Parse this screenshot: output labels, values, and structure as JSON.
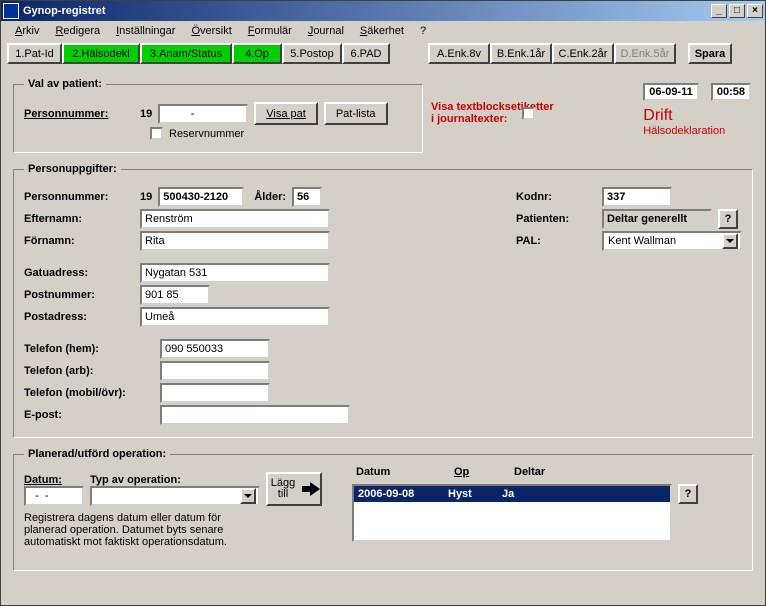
{
  "window": {
    "title": "Gynop-registret"
  },
  "menu": {
    "arkiv": "Arkiv",
    "redigera": "Redigera",
    "installningar": "Inställningar",
    "oversikt": "Översikt",
    "formular": "Formulär",
    "journal": "Journal",
    "sakerhet": "Säkerhet",
    "help": "?"
  },
  "tabs": {
    "t1": "1.Pat-Id",
    "t2": "2.Hälsodekl",
    "t3": "3.Anam/Status",
    "t4": "4.Op",
    "t5": "5.Postop",
    "t6": "6.PAD",
    "a": "A.Enk.8v",
    "b": "B.Enk.1år",
    "c": "C.Enk.2år",
    "d": "D.Enk.5år",
    "spara": "Spara"
  },
  "val": {
    "legend": "Val av patient:",
    "personnummer_label": "Personnummer:",
    "prefix": "19",
    "pnr_value": "         -",
    "visa_pat": "Visa pat",
    "pat_lista": "Pat-lista",
    "reservnummer": "Reservnummer"
  },
  "red": {
    "line1": "Visa textblocksetiketter",
    "line2": "i journaltexter:"
  },
  "status": {
    "date": "06-09-11",
    "time": "00:58",
    "mode": "Drift",
    "sub": "Hälsodeklaration"
  },
  "person": {
    "legend": "Personuppgifter:",
    "personnummer_label": "Personnummer:",
    "prefix": "19",
    "pnr": "500430-2120",
    "alder_label": "Ålder:",
    "alder": "56",
    "efternamn_label": "Efternamn:",
    "efternamn": "Renström",
    "fornamn_label": "Förnamn:",
    "fornamn": "Rita",
    "gatuadress_label": "Gatuadress:",
    "gatuadress": "Nygatan 531",
    "postnummer_label": "Postnummer:",
    "postnummer": "901 85",
    "postadress_label": "Postadress:",
    "postadress": "Umeå",
    "tel_hem_label": "Telefon (hem):",
    "tel_hem": "090 550033",
    "tel_arb_label": "Telefon (arb):",
    "tel_arb": "",
    "tel_mob_label": "Telefon (mobil/övr):",
    "tel_mob": "",
    "epost_label": "E-post:",
    "epost": "",
    "kodnr_label": "Kodnr:",
    "kodnr": "337",
    "patienten_label": "Patienten:",
    "patienten": "Deltar generellt",
    "pal_label": "PAL:",
    "pal": "Kent Wallman"
  },
  "op": {
    "legend": "Planerad/utförd operation:",
    "datum_label": "Datum:",
    "datum_value": "  -  -  ",
    "typ_label": "Typ av operation:",
    "typ_value": "",
    "lagg": "Lägg till",
    "th_datum": "Datum",
    "th_op": "Op",
    "th_deltar": "Deltar",
    "row_datum": "2006-09-08",
    "row_op": "Hyst",
    "row_deltar": "Ja",
    "help_text": "Registrera dagens datum eller datum för planerad operation. Datumet byts senare automatiskt mot faktiskt operationsdatum."
  }
}
